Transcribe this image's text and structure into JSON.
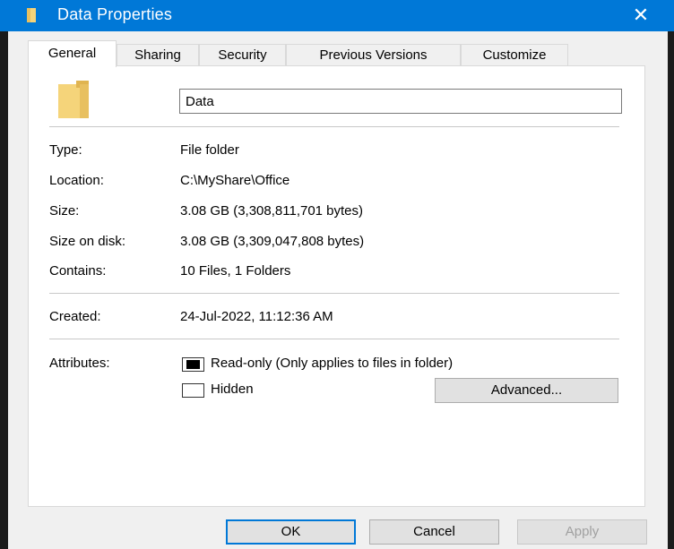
{
  "window": {
    "title": "Data Properties"
  },
  "tabs": [
    {
      "label": "General"
    },
    {
      "label": "Sharing"
    },
    {
      "label": "Security"
    },
    {
      "label": "Previous Versions"
    },
    {
      "label": "Customize"
    }
  ],
  "general": {
    "folder_name": "Data",
    "type_label": "Type:",
    "type_value": "File folder",
    "location_label": "Location:",
    "location_value": "C:\\MyShare\\Office",
    "size_label": "Size:",
    "size_value": "3.08 GB (3,308,811,701 bytes)",
    "size_on_disk_label": "Size on disk:",
    "size_on_disk_value": "3.08 GB (3,309,047,808 bytes)",
    "contains_label": "Contains:",
    "contains_value": "10 Files, 1 Folders",
    "created_label": "Created:",
    "created_value": "24-Jul-2022, 11:12:36 AM",
    "attributes_label": "Attributes:",
    "readonly_label": "Read-only (Only applies to files in folder)",
    "hidden_label": "Hidden",
    "advanced_label": "Advanced..."
  },
  "buttons": {
    "ok": "OK",
    "cancel": "Cancel",
    "apply": "Apply"
  },
  "icons": {
    "close": "close-icon",
    "folder": "folder-icon"
  },
  "colors": {
    "accent": "#0078d7",
    "folder": "#f5d47a"
  }
}
